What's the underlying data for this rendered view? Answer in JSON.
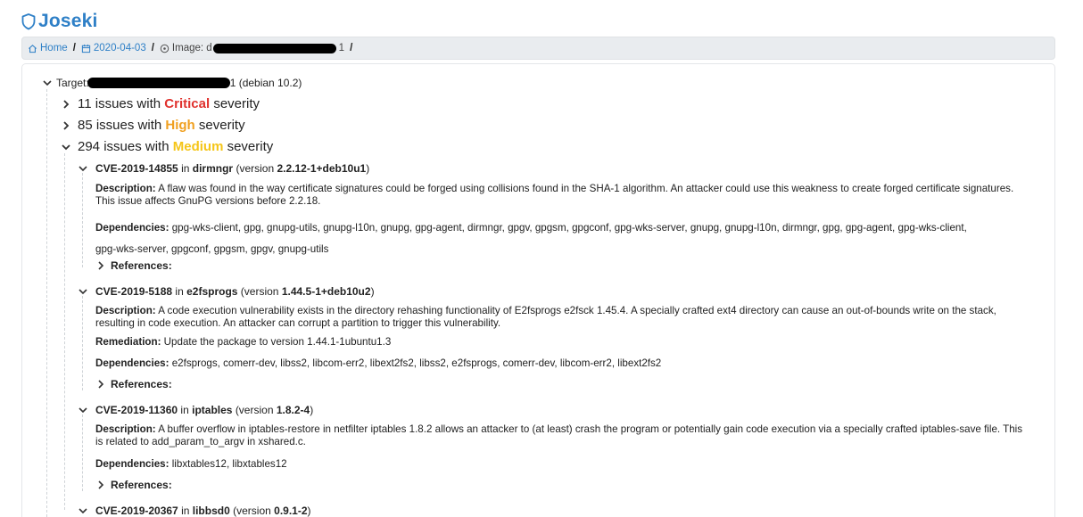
{
  "app": {
    "title": "Joseki",
    "brand_color": "#2f80c7",
    "logo_icon": "shield-icon"
  },
  "breadcrumb": {
    "home_label": "Home",
    "date_label": "2020-04-03",
    "image_label": "Image: d",
    "image_tail": "1",
    "separator": "/"
  },
  "target": {
    "prefix": "Target:",
    "suffix": "1 (debian 10.2)"
  },
  "severity_groups": [
    {
      "count_text": "11 issues with",
      "level": "Critical",
      "suffix": "severity",
      "color": "#e0322e",
      "expanded": false
    },
    {
      "count_text": "85 issues with",
      "level": "High",
      "suffix": "severity",
      "color": "#f0a020",
      "expanded": false
    },
    {
      "count_text": "294 issues with",
      "level": "Medium",
      "suffix": "severity",
      "color": "#f5c518",
      "expanded": true
    }
  ],
  "vulnerabilities": [
    {
      "id": "CVE-2019-14855",
      "in_text": "in",
      "package": "dirmngr",
      "version_prefix": "(version",
      "version": "2.2.12-1+deb10u1",
      "version_suffix": ")",
      "description_label": "Description:",
      "description": "A flaw was found in the way certificate signatures could be forged using collisions found in the SHA-1 algorithm. An attacker could use this weakness to create forged certificate signatures. This issue affects GnuPG versions before 2.2.18.",
      "dependencies_label": "Dependencies:",
      "dependencies": "gpg-wks-client, gpg, gnupg-utils, gnupg-l10n, gnupg, gpg-agent, dirmngr, gpgv, gpgsm, gpgconf, gpg-wks-server, gnupg, gnupg-l10n, dirmngr, gpg, gpg-agent, gpg-wks-client,",
      "dependencies_cont": "gpg-wks-server, gpgconf, gpgsm, gpgv, gnupg-utils",
      "references_label": "References:"
    },
    {
      "id": "CVE-2019-5188",
      "in_text": "in",
      "package": "e2fsprogs",
      "version_prefix": "(version",
      "version": "1.44.5-1+deb10u2",
      "version_suffix": ")",
      "description_label": "Description:",
      "description": "A code execution vulnerability exists in the directory rehashing functionality of E2fsprogs e2fsck 1.45.4. A specially crafted ext4 directory can cause an out-of-bounds write on the stack, resulting in code execution. An attacker can corrupt a partition to trigger this vulnerability.",
      "remediation_label": "Remediation:",
      "remediation": "Update the package to version 1.44.1-1ubuntu1.3",
      "dependencies_label": "Dependencies:",
      "dependencies": "e2fsprogs, comerr-dev, libss2, libcom-err2, libext2fs2, libss2, e2fsprogs, comerr-dev, libcom-err2, libext2fs2",
      "references_label": "References:"
    },
    {
      "id": "CVE-2019-11360",
      "in_text": "in",
      "package": "iptables",
      "version_prefix": "(version",
      "version": "1.8.2-4",
      "version_suffix": ")",
      "description_label": "Description:",
      "description": "A buffer overflow in iptables-restore in netfilter iptables 1.8.2 allows an attacker to (at least) crash the program or potentially gain code execution via a specially crafted iptables-save file. This is related to add_param_to_argv in xshared.c.",
      "dependencies_label": "Dependencies:",
      "dependencies": "libxtables12, libxtables12",
      "references_label": "References:"
    },
    {
      "id": "CVE-2019-20367",
      "in_text": "in",
      "package": "libbsd0",
      "version_prefix": "(version",
      "version": "0.9.1-2",
      "version_suffix": ")"
    }
  ]
}
